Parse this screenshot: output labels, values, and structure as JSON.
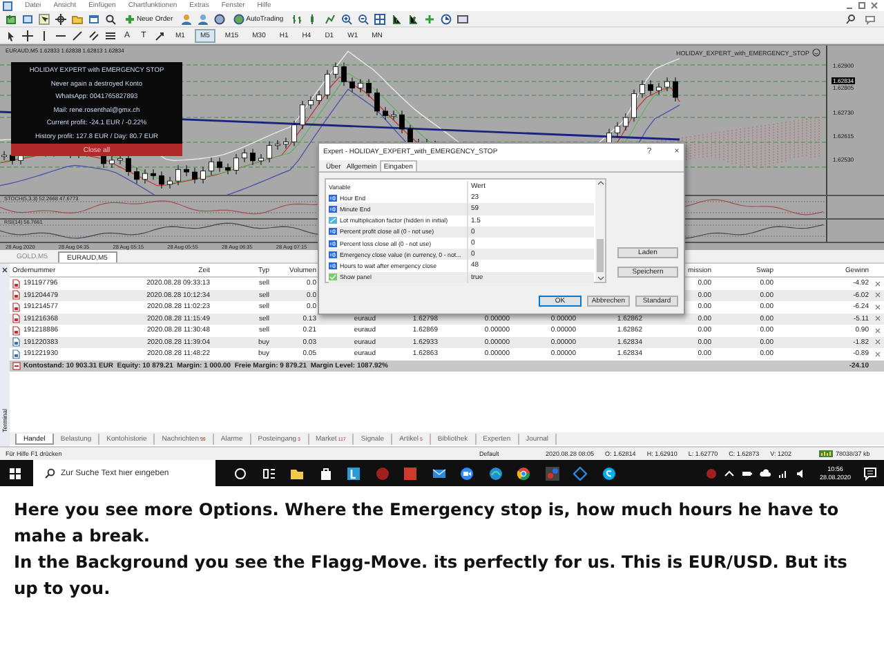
{
  "menu_bar": {
    "items": [
      "Datei",
      "Ansicht",
      "Einfügen",
      "Chartfunktionen",
      "Extras",
      "Fenster",
      "Hilfe"
    ]
  },
  "toolbar": {
    "buttons": [
      "Neue Order",
      "AutoTrading"
    ]
  },
  "drawing_tools": {
    "text_tools": [
      "A",
      "T"
    ],
    "timeframes": [
      {
        "label": "M1",
        "selected": false
      },
      {
        "label": "M5",
        "selected": true
      },
      {
        "label": "M15",
        "selected": false
      },
      {
        "label": "M30",
        "selected": false
      },
      {
        "label": "H1",
        "selected": false
      },
      {
        "label": "H4",
        "selected": false
      },
      {
        "label": "D1",
        "selected": false
      },
      {
        "label": "W1",
        "selected": false
      },
      {
        "label": "MN",
        "selected": false
      }
    ]
  },
  "chart": {
    "header": "EURAUD,M5  1.62833 1.62838 1.62813 1.62834",
    "expert_label": "HOLIDAY_EXPERT_with_EMERGENCY_STOP",
    "price_labels": [
      {
        "text": "1.62900",
        "current": false
      },
      {
        "text": "1.62834",
        "current": true
      },
      {
        "text": "1.62805",
        "current": false
      },
      {
        "text": "1.62730",
        "current": false
      },
      {
        "text": "1.62615",
        "current": false
      },
      {
        "text": "1.62530",
        "current": false
      }
    ],
    "indicators": [
      "STOCH(5,3,3) 52.2668 47.6773",
      "RSI(14) 56.7661"
    ],
    "time_labels": [
      "28 Aug 2020",
      "28 Aug 04:35",
      "28 Aug 05:15",
      "28 Aug 05:55",
      "28 Aug 06:35",
      "28 Aug 07:15"
    ]
  },
  "info_panel": {
    "title": "HOLIDAY EXPERT with EMERGENCY STOP",
    "lines": [
      "Never again a destroyed Konto",
      "WhatsApp: 0041765827893",
      "Mail: rene.rosenthal@gmx.ch",
      "Current profit: -24.1 EUR / -0.22%",
      "History profit: 127.8 EUR / Day: 80.7 EUR"
    ],
    "button": "Close all"
  },
  "chart_tabs": [
    {
      "label": "GOLD,M5",
      "selected": false
    },
    {
      "label": "EURAUD,M5",
      "selected": true
    }
  ],
  "terminal": {
    "label": "Terminal",
    "columns": [
      "Ordernummer",
      "Zeit",
      "Typ",
      "Volumen",
      "mission",
      "Swap",
      "Gewinn"
    ],
    "rows": [
      {
        "kind": "sell",
        "cells": [
          "191197796",
          "2020.08.28 09:33:13",
          "sell",
          "0.0",
          "0.00",
          "0.00",
          "-4.92"
        ]
      },
      {
        "kind": "sell",
        "cells": [
          "191204479",
          "2020.08.28 10:12:34",
          "sell",
          "0.0",
          "0.00",
          "0.00",
          "-6.02"
        ]
      },
      {
        "kind": "sell",
        "cells": [
          "191214577",
          "2020.08.28 11:02:23",
          "sell",
          "0.0",
          "0.00",
          "0.00",
          "-6.24"
        ]
      },
      {
        "kind": "sell",
        "cells": [
          "191216368",
          "2020.08.28 11:15:49",
          "sell",
          "0.13",
          "euraud",
          "1.62798",
          "0.00000",
          "0.00000",
          "1.62862",
          "0.00",
          "0.00",
          "-5.11"
        ]
      },
      {
        "kind": "sell",
        "cells": [
          "191218886",
          "2020.08.28 11:30:48",
          "sell",
          "0.21",
          "euraud",
          "1.62869",
          "0.00000",
          "0.00000",
          "1.62862",
          "0.00",
          "0.00",
          "0.90"
        ]
      },
      {
        "kind": "buy",
        "cells": [
          "191220383",
          "2020.08.28 11:39:04",
          "buy",
          "0.03",
          "euraud",
          "1.62933",
          "0.00000",
          "0.00000",
          "1.62834",
          "0.00",
          "0.00",
          "-1.82"
        ]
      },
      {
        "kind": "buy",
        "cells": [
          "191221930",
          "2020.08.28 11:48:22",
          "buy",
          "0.05",
          "euraud",
          "1.62863",
          "0.00000",
          "0.00000",
          "1.62834",
          "0.00",
          "0.00",
          "-0.89"
        ]
      }
    ],
    "summary": {
      "text": "Kontostand: 10 903.31 EUR  Equity: 10 879.21  Margin: 1 000.00  Freie Margin: 9 879.21  Margin Level: 1087.92%",
      "total": "-24.10"
    },
    "tabs": [
      {
        "label": "Handel",
        "selected": true
      },
      {
        "label": "Belastung",
        "selected": false
      },
      {
        "label": "Kontohistorie",
        "selected": false
      },
      {
        "label": "Nachrichten",
        "badge": "99",
        "selected": false
      },
      {
        "label": "Alarme",
        "selected": false
      },
      {
        "label": "Posteingang",
        "badge": "3",
        "selected": false
      },
      {
        "label": "Market",
        "badge": "117",
        "selected": false
      },
      {
        "label": "Signale",
        "selected": false
      },
      {
        "label": "Artikel",
        "badge": "5",
        "selected": false
      },
      {
        "label": "Bibliothek",
        "selected": false
      },
      {
        "label": "Experten",
        "selected": false
      },
      {
        "label": "Journal",
        "selected": false
      }
    ]
  },
  "dialog": {
    "title": "Expert - HOLIDAY_EXPERT_with_EMERGENCY_STOP",
    "help": "?",
    "close": "×",
    "tabs": [
      {
        "label": "Über",
        "selected": false
      },
      {
        "label": "Allgemein",
        "selected": false
      },
      {
        "label": "Eingaben",
        "selected": true
      }
    ],
    "columns": [
      "Variable",
      "Wert"
    ],
    "params": [
      {
        "kind": "int",
        "variable": "Hour End",
        "value": "23"
      },
      {
        "kind": "int",
        "variable": "Minute End",
        "value": "59"
      },
      {
        "kind": "double",
        "variable": "Lot multiplication factor (hidden in initial)",
        "value": "1.5"
      },
      {
        "kind": "int",
        "variable": "Percent profit close all (0 - not use)",
        "value": "0"
      },
      {
        "kind": "int",
        "variable": "Percent loss close all (0 - not use)",
        "value": "0"
      },
      {
        "kind": "int",
        "variable": "Emergency close value (in currency, 0 - not...",
        "value": "0"
      },
      {
        "kind": "int",
        "variable": "Hours to wait after emergency close",
        "value": "48"
      },
      {
        "kind": "bool",
        "variable": "Show panel",
        "value": "true"
      }
    ],
    "side_buttons": [
      "Laden",
      "Speichern"
    ],
    "buttons": [
      {
        "label": "OK",
        "default": true
      },
      {
        "label": "Abbrechen",
        "default": false
      },
      {
        "label": "Standard",
        "default": false
      }
    ]
  },
  "status_bar": {
    "help": "Für Hilfe F1 drücken",
    "profile": "Default",
    "items": [
      "2020.08.28 08:05",
      "O: 1.62814",
      "H: 1.62910",
      "L: 1.62770",
      "C: 1.62873",
      "V: 1202"
    ],
    "traffic": "78038/37 kb"
  },
  "taskbar": {
    "search_placeholder": "Zur Suche Text hier eingeben",
    "time": "10:56",
    "date": "28.08.2020"
  },
  "caption": [
    "Here you see more Options. Where the Emergency stop is, how much hours he have to mahe a break.",
    "In the Background you see the Flagg-Move. its perfectly for us. This is EUR/USD. But its up to you."
  ]
}
